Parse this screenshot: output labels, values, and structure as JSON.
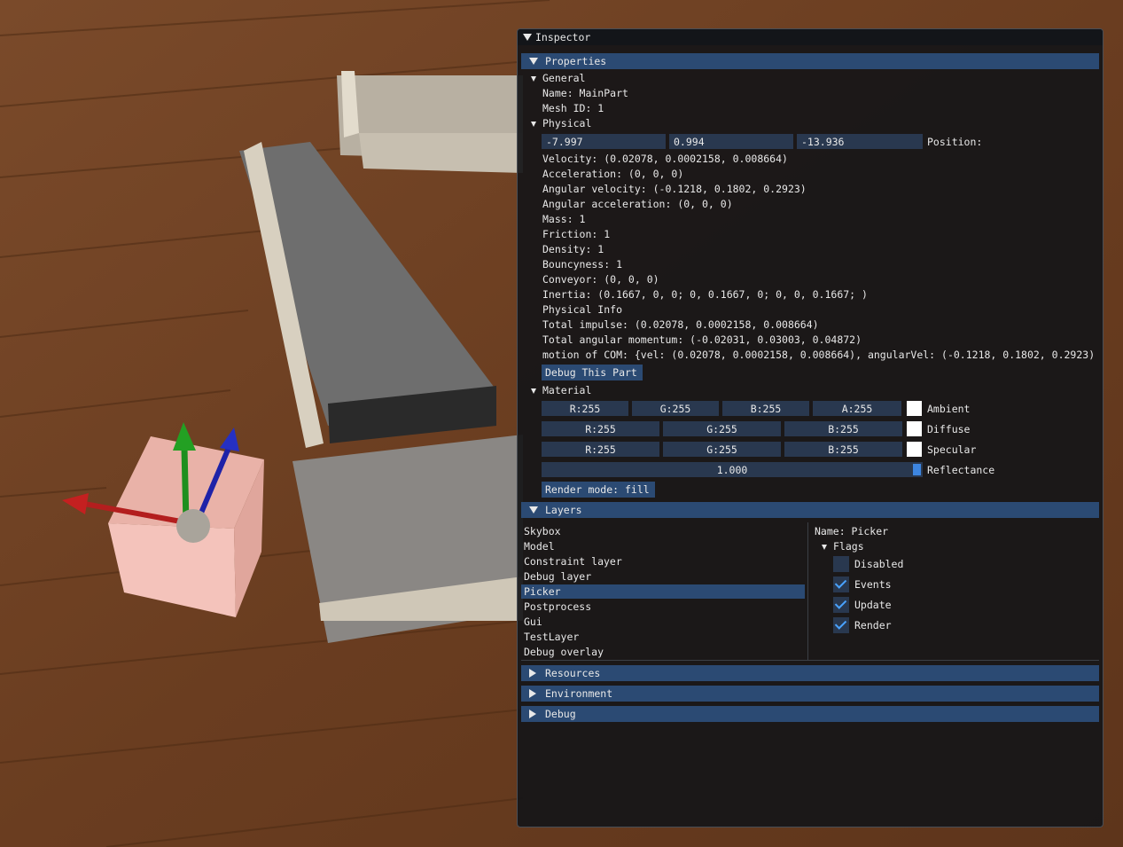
{
  "window": {
    "title": "Inspector"
  },
  "properties": {
    "header": "Properties",
    "general": {
      "label": "General",
      "name": "Name: MainPart",
      "mesh_id": "Mesh ID: 1"
    },
    "physical": {
      "label": "Physical",
      "position": {
        "x": "-7.997",
        "y": "0.994",
        "z": "-13.936",
        "label": "Position:"
      },
      "lines": [
        "Velocity: (0.02078, 0.0002158, 0.008664)",
        "Acceleration: (0, 0, 0)",
        "Angular velocity: (-0.1218, 0.1802, 0.2923)",
        "Angular acceleration: (0, 0, 0)",
        "Mass: 1",
        "Friction: 1",
        "Density: 1",
        "Bouncyness: 1",
        "Conveyor: (0, 0, 0)",
        "Inertia: (0.1667, 0, 0; 0, 0.1667, 0; 0, 0, 0.1667; )",
        "Physical Info",
        "Total impulse: (0.02078, 0.0002158, 0.008664)",
        "Total angular momentum: (-0.02031, 0.03003, 0.04872)",
        "motion of COM: {vel: (0.02078, 0.0002158, 0.008664), angularVel: (-0.1218, 0.1802, 0.2923)"
      ],
      "debug_button": "Debug This Part"
    },
    "material": {
      "label": "Material",
      "ambient": {
        "r": "R:255",
        "g": "G:255",
        "b": "B:255",
        "a": "A:255",
        "label": "Ambient"
      },
      "diffuse": {
        "r": "R:255",
        "g": "G:255",
        "b": "B:255",
        "label": "Diffuse"
      },
      "specular": {
        "r": "R:255",
        "g": "G:255",
        "b": "B:255",
        "label": "Specular"
      },
      "reflectance": {
        "value": "1.000",
        "label": "Reflectance"
      },
      "render_mode": "Render mode: fill"
    }
  },
  "layers": {
    "header": "Layers",
    "items": [
      "Skybox",
      "Model",
      "Constraint layer",
      "Debug layer",
      "Picker",
      "Postprocess",
      "Gui",
      "TestLayer",
      "Debug overlay"
    ],
    "selected_index": 4,
    "detail": {
      "name": "Name: Picker",
      "flags_label": "Flags",
      "flags": [
        {
          "label": "Disabled",
          "checked": false
        },
        {
          "label": "Events",
          "checked": true
        },
        {
          "label": "Update",
          "checked": true
        },
        {
          "label": "Render",
          "checked": true
        }
      ]
    }
  },
  "collapsed_headers": [
    "Resources",
    "Environment",
    "Debug"
  ],
  "colors": {
    "header_bg": "#2b4a73",
    "field_bg": "#29384f",
    "check_accent": "#4aa3ff",
    "window_bg": "#161618"
  },
  "icons": [
    "collapse-arrow-icon",
    "expand-arrow-icon",
    "checkmark-icon"
  ]
}
